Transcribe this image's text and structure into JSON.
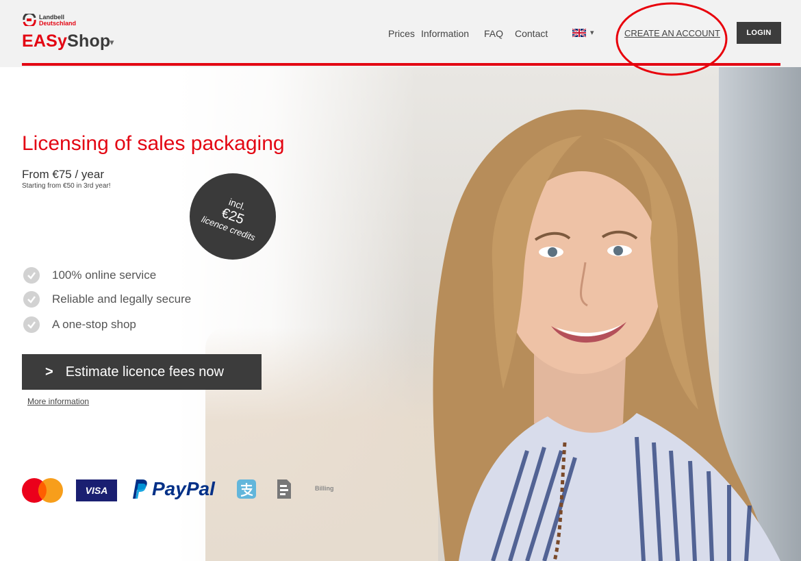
{
  "logo": {
    "brand_line1": "Landbell",
    "brand_line2": "Deutschland",
    "name_part1": "EASy",
    "name_part2": "Shop",
    "caret": "▾"
  },
  "nav": {
    "items": [
      "Prices",
      "Information",
      "FAQ",
      "Contact"
    ],
    "language_caret": "▾",
    "language_icon": "uk-flag-icon",
    "create_account": "CREATE AN ACCOUNT",
    "login": "LOGIN"
  },
  "hero": {
    "title": "Licensing of sales packaging",
    "price": "From €75 / year",
    "price_note": "Starting from €50 in 3rd year!",
    "badge": {
      "line1": "incl.",
      "line2": "€25",
      "line3": "licence credits"
    },
    "features": [
      "100% online service",
      "Reliable and legally secure",
      "A one-stop shop"
    ],
    "cta_label": "Estimate licence fees now",
    "more_info": "More information"
  },
  "payments": {
    "icons": [
      "mastercard-icon",
      "visa-icon",
      "paypal-icon",
      "alipay-icon",
      "billing-icon"
    ],
    "visa_text": "VISA",
    "paypal_text": "PayPal",
    "billing_text": "Billing"
  },
  "colors": {
    "brand_red": "#e30613",
    "dark": "#3c3c3c",
    "header_bg": "#f2f2f2",
    "annotation": "#e8000b"
  }
}
